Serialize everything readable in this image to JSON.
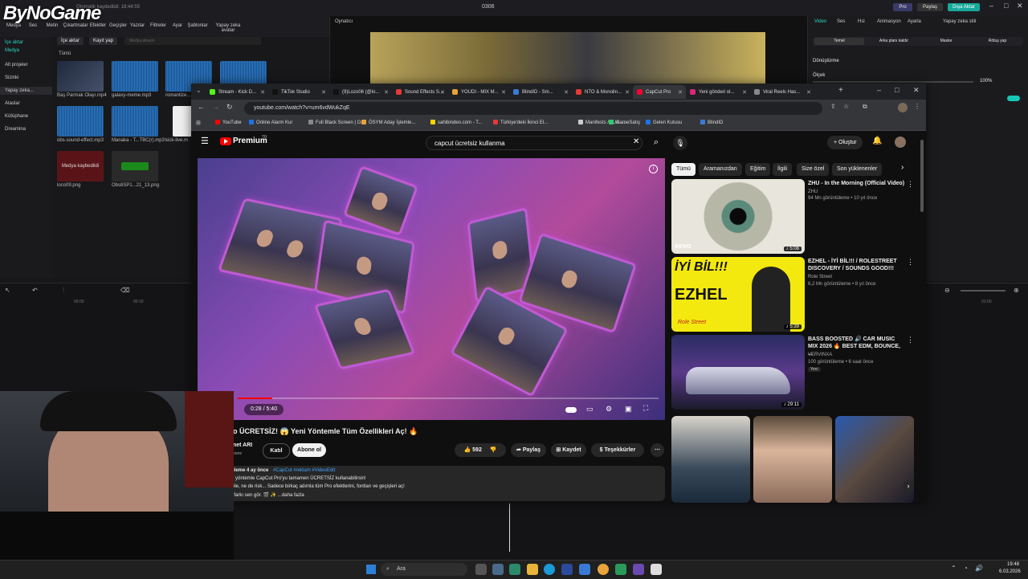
{
  "logo": {
    "text": "ByNoGame"
  },
  "capcut": {
    "title": "0306",
    "autosave": "Otomatik kaydedildi: 18:44:55",
    "tools": [
      "Medya",
      "Ses",
      "Metin",
      "Çıkartmalar",
      "Efektler",
      "Geçişler",
      "Yazılar",
      "Filtreler",
      "Ayar",
      "Şablonlar",
      "Yapay zeka avatar"
    ],
    "sidebar": [
      "İçe aktar",
      "Medya",
      "Alt projeler",
      "Sizinki",
      "Yapay zeka...",
      "Ataslar",
      "Kütüphane",
      "Dreamina"
    ],
    "media_toolbar": {
      "import": "İçe aktar",
      "record": "Kayıt yap",
      "search_placeholder": "Medya abayın"
    },
    "media_filter": "Tümü",
    "media_files": [
      "Baş Parmak Olayı.mp4",
      "galaxy-meme.mp3",
      "romantize...",
      "",
      "obs-sound-effect.mp3",
      "Manaka - T...TBC(r).mp3",
      "kick-live.m",
      "loco09.png",
      "Obs8SP1...21_13.png"
    ],
    "media_badges": [
      "Eklendi",
      "Eklendi",
      "Eklendi",
      "Eklendi",
      "Eklendi",
      "Eklendi",
      "Eklendi",
      "Eklendi"
    ],
    "durations": [
      "00:04",
      "00:02",
      "00:02"
    ],
    "lost_media": "Medya kaybedildi",
    "player_label": "Oynatıcı",
    "right_tabs": [
      "Video",
      "Ses",
      "Hız",
      "Animasyon",
      "Ayarla",
      "Yapay zeka stili"
    ],
    "right_subtabs": [
      "Temel",
      "Arka planı kaldır",
      "Maske",
      "Rötuş yap"
    ],
    "transform_label": "Dönüştürme",
    "scale_label": "Ölçek",
    "scale_value": "100%",
    "header_buttons": [
      "Pro",
      "Paylaş",
      "Dışa Aktar"
    ],
    "timeline_times": [
      "00:00",
      "00:10",
      "00:20",
      "01:00"
    ]
  },
  "browser": {
    "tabs": [
      {
        "label": "Stream - Kick D...",
        "color": "#53fc18"
      },
      {
        "label": "TikTok Studio",
        "color": "#111111"
      },
      {
        "label": "(9)Lozo06 (@lo...",
        "color": "#111111"
      },
      {
        "label": "Sound Effects S...",
        "color": "#e53935"
      },
      {
        "label": "YOUDI - MIX M...",
        "color": "#e8a33a"
      },
      {
        "label": "BlindID - Sm...",
        "color": "#3a7bd5"
      },
      {
        "label": "NTO & Monolin...",
        "color": "#e53935"
      },
      {
        "label": "CapCut Pro",
        "color": "#ff0033"
      },
      {
        "label": "Yeni gönderi ol...",
        "color": "#d62976"
      },
      {
        "label": "Viral Reels Has...",
        "color": "#888888"
      }
    ],
    "url": "youtube.com/watch?v=um6vdWukZqE",
    "bookmarks": [
      {
        "label": "YouTube",
        "color": "#ff0000"
      },
      {
        "label": "Online Alarm Kur",
        "color": "#1a73e8"
      },
      {
        "label": "Full Black Screen | O...",
        "color": "#888888"
      },
      {
        "label": "ÖSYM Aday İşlemle...",
        "color": "#e8a33a"
      },
      {
        "label": "sahibinden.com - T...",
        "color": "#ffd400"
      },
      {
        "label": "Türkiye'deki İkinci El...",
        "color": "#e53935"
      },
      {
        "label": "Manifests / LUA -...",
        "color": "#cccccc"
      },
      {
        "label": "GameSatış",
        "color": "#2ecc71"
      },
      {
        "label": "Gelen Kutusu",
        "color": "#1a73e8"
      },
      {
        "label": "BlindID",
        "color": "#3a7bd5"
      }
    ]
  },
  "youtube": {
    "logo": "Premium",
    "logo_sup": "TR",
    "search_query": "capcut ücretsiz kullanma",
    "create_label": "Oluştur",
    "chips": [
      "Tümü",
      "Aramanızdan",
      "Eğitim",
      "İlgili",
      "Size özel",
      "Son yüklenenler"
    ],
    "time": "0:28 / 5:40",
    "progress": 0.082,
    "video_title": "o ÜCRETSİZ! 😱 Yeni Yöntemle Tüm Özellikleri Aç! 🔥",
    "channel": "net ARI",
    "channel_sub": "bone",
    "join_label": "Katıl",
    "subscribe_label": "Abone ol",
    "likes": "592",
    "share_label": "Paylaş",
    "save_label": "Kaydet",
    "thanks_label": "Teşekkürler",
    "desc_meta": "üleme  4 ay önce",
    "desc_tags": "#CapCut #reklam #VideoEdit",
    "desc_line1": "u yöntemle CapCut Pro'yu tamamen ÜCRETSİZ kullanabilirsin!",
    "desc_line2": "zile, ne de risk... Sadece birkaç adımla tüm Pro efektlerini, fontları ve geçişleri aç!",
    "desc_line3": ", farkı sen gör. 🎬 ✨  ...daha fazla",
    "recommendations": [
      {
        "title": "ZHU - In the Morning (Official Video)",
        "channel": "ZHU",
        "meta": "94 Mn görüntüleme • 10 yıl önce",
        "duration": "5:08",
        "badge": "",
        "brand": "vevo"
      },
      {
        "title": "EZHEL - İYİ BİL!!! / ROLESTREET DISCOVERY / SOUNDS GOOD!!!",
        "channel": "Role Street",
        "meta": "6,2 Mn görüntüleme • 8 yıl önce",
        "duration": "5:39",
        "badge": ""
      },
      {
        "title": "BASS BOOSTED 🔊 CAR MUSIC MIX 2026 🔥 BEST EDM, BOUNCE, ...",
        "channel": "VERVINXA",
        "meta": "100 görüntüleme • 6 saat önce",
        "duration": "29:11",
        "badge": "Yeni"
      }
    ],
    "thumb_text": {
      "ezhel_top": "İYİ BİL!!!",
      "ezhel_name": "EZHEL",
      "ezhel_sign": "Role Street"
    }
  },
  "taskbar": {
    "search_placeholder": "Ara",
    "time": "19:48",
    "date": "6.03.2026"
  }
}
